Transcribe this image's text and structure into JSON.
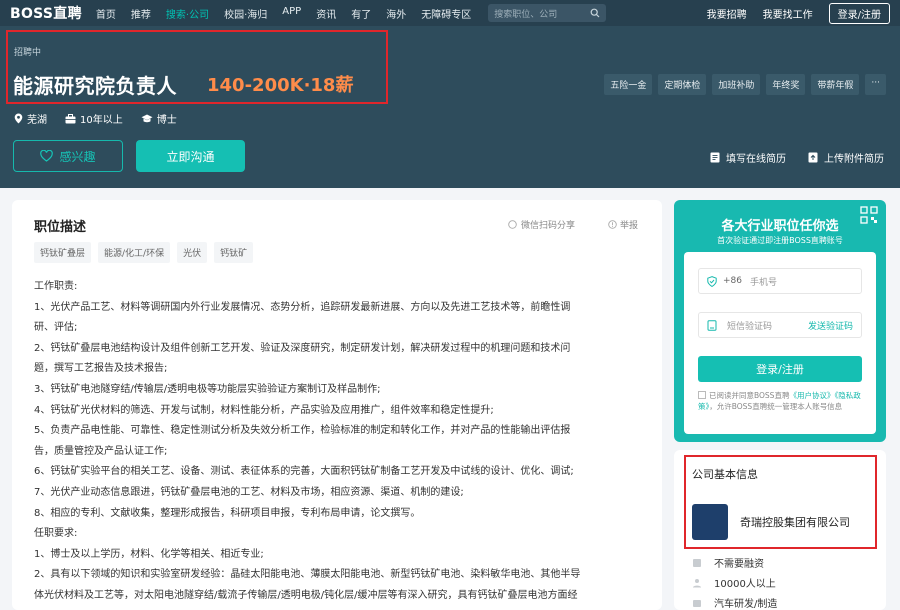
{
  "topnav": {
    "logo": "BOSS直聘",
    "items": [
      "首页",
      "推荐",
      "搜索·公司",
      "校园·海归",
      "APP",
      "资讯",
      "有了",
      "海外",
      "无障碍专区"
    ],
    "active_index": 2,
    "search_placeholder": "搜索职位、公司",
    "right_links": [
      "我要招聘",
      "我要找工作"
    ],
    "login": "登录/注册"
  },
  "job": {
    "status": "招聘中",
    "title": "能源研究院负责人",
    "salary": "140-200K·18薪",
    "location": "芜湖",
    "experience": "10年以上",
    "degree": "博士",
    "benefits": [
      "五险一金",
      "定期体检",
      "加班补助",
      "年终奖",
      "带薪年假",
      "···"
    ],
    "interest_label": "感兴趣",
    "chat_label": "立即沟通",
    "fill_resume": "填写在线简历",
    "upload_resume": "上传附件简历"
  },
  "detail": {
    "section_title": "职位描述",
    "share": "微信扫码分享",
    "report": "举报",
    "keywords": [
      "钙钛矿叠层",
      "能源/化工/环保",
      "光伏",
      "钙钛矿"
    ],
    "lines": [
      "工作职责:",
      "1、光伏产品工艺、材料等调研国内外行业发展情况、态势分析，追踪研发最新进展、方向以及先进工艺技术等，前瞻性调",
      "研、评估;",
      "2、钙钛矿叠层电池结构设计及组件创新工艺开发、验证及深度研究，制定研发计划，解决研发过程中的机理问题和技术问",
      "题，撰写工艺报告及技术报告;",
      "3、钙钛矿电池隧穿结/传输层/透明电极等功能层实验验证方案制订及样品制作;",
      "4、钙钛矿光伏材料的筛选、开发与试制，材料性能分析，产品实验及应用推广，组件效率和稳定性提升;",
      "5、负责产品电性能、可靠性、稳定性测试分析及失效分析工作，检验标准的制定和转化工作，并对产品的性能输出评估报",
      "告，质量管控及产品认证工作;",
      "6、钙钛矿实验平台的相关工艺、设备、测试、表征体系的完善，大面积钙钛矿制备工艺开发及中试线的设计、优化、调试;",
      "7、光伏产业动态信息跟进，钙钛矿叠层电池的工艺、材料及市场，相应资源、渠道、机制的建设;",
      "8、相应的专利、文献收集，整理形成报告，科研项目申报，专利布局申请，论文撰写。",
      "任职要求:",
      "1、博士及以上学历，材料、化学等相关、相近专业;",
      "2、具有以下领域的知识和实验室研发经验：晶硅太阳能电池、薄膜太阳能电池、新型钙钛矿电池、染料敏华电池、其他半导",
      "体光伏材料及工艺等，对太阳电池隧穿结/载流子传输层/透明电极/钝化层/缓冲层等有深入研究，具有钙钛矿叠层电池方面经"
    ]
  },
  "login_card": {
    "title": "各大行业职位任你选",
    "subtitle": "首次验证通过即注册BOSS直聘账号",
    "country_code": "+86",
    "phone_placeholder": "手机号",
    "code_placeholder": "短信验证码",
    "send_code": "发送验证码",
    "submit": "登录/注册",
    "agree_prefix": "已阅读并同意BOSS直聘",
    "user_agreement": "《用户协议》",
    "privacy_policy": "《隐私政策》",
    "agree_suffix": "，允许BOSS直聘统一管理本人账号信息"
  },
  "company": {
    "section_title": "公司基本信息",
    "name": "奇瑞控股集团有限公司",
    "financing": "不需要融资",
    "size": "10000人以上",
    "industry": "汽车研发/制造"
  }
}
